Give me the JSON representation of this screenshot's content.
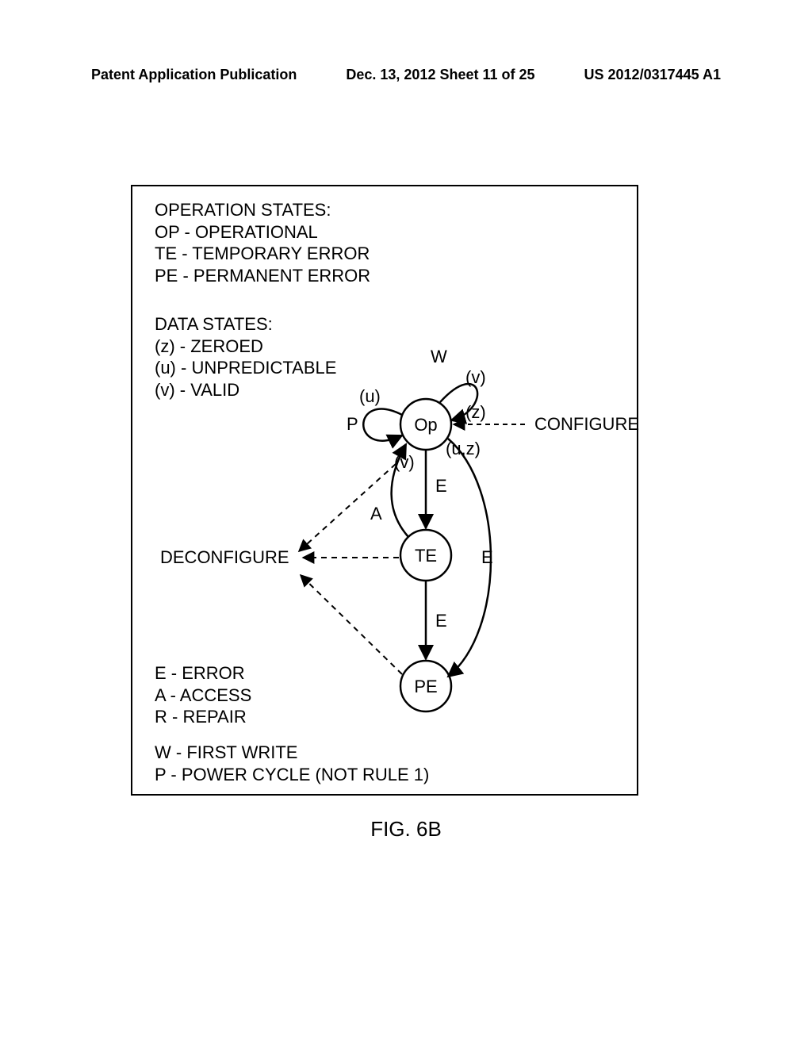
{
  "header": {
    "left": "Patent Application Publication",
    "center": "Dec. 13, 2012  Sheet 11 of 25",
    "right": "US 2012/0317445 A1"
  },
  "operation_states": {
    "title": "OPERATION STATES:",
    "items": [
      "OP - OPERATIONAL",
      "TE - TEMPORARY ERROR",
      "PE - PERMANENT ERROR"
    ]
  },
  "data_states": {
    "title": "DATA STATES:",
    "items": [
      "(z) - ZEROED",
      "(u) - UNPREDICTABLE",
      "(v) - VALID"
    ]
  },
  "event_legend": {
    "items": [
      "E - ERROR",
      "A - ACCESS",
      "R - REPAIR"
    ]
  },
  "event_legend2": {
    "items": [
      "W - FIRST WRITE",
      "P - POWER CYCLE (NOT RULE 1)"
    ]
  },
  "nodes": {
    "op": "Op",
    "te": "TE",
    "pe": "PE"
  },
  "edge_labels": {
    "w": "W",
    "p": "P",
    "e1": "E",
    "e2": "E",
    "e3": "E",
    "a": "A",
    "z": "(z)",
    "v_top": "(v)",
    "u": "(u)",
    "v2": "(v)",
    "uz": "(u,z)",
    "configure": "CONFIGURE",
    "deconfigure": "DECONFIGURE"
  },
  "caption": "FIG. 6B",
  "chart_data": {
    "type": "state_diagram",
    "states": [
      {
        "id": "Op",
        "label": "Operational"
      },
      {
        "id": "TE",
        "label": "Temporary Error"
      },
      {
        "id": "PE",
        "label": "Permanent Error"
      }
    ],
    "data_states": [
      {
        "id": "z",
        "label": "Zeroed"
      },
      {
        "id": "u",
        "label": "Unpredictable"
      },
      {
        "id": "v",
        "label": "Valid"
      }
    ],
    "events": [
      {
        "id": "E",
        "label": "Error"
      },
      {
        "id": "A",
        "label": "Access"
      },
      {
        "id": "R",
        "label": "Repair"
      },
      {
        "id": "W",
        "label": "First Write"
      },
      {
        "id": "P",
        "label": "Power Cycle (Not Rule 1)"
      }
    ],
    "transitions": [
      {
        "from": "CONFIGURE",
        "to": "Op",
        "data": "z"
      },
      {
        "from": "Op",
        "to": "Op",
        "event": "W",
        "data": "v"
      },
      {
        "from": "Op",
        "to": "Op",
        "event": "P",
        "data": "u"
      },
      {
        "from": "Op",
        "to": "TE",
        "event": "E",
        "data": "u,z"
      },
      {
        "from": "Op",
        "to": "PE",
        "event": "E"
      },
      {
        "from": "TE",
        "to": "Op",
        "event": "A",
        "data": "v"
      },
      {
        "from": "TE",
        "to": "PE",
        "event": "E"
      },
      {
        "from": "TE",
        "to": "DECONFIGURE"
      },
      {
        "from": "PE",
        "to": "DECONFIGURE"
      }
    ]
  }
}
